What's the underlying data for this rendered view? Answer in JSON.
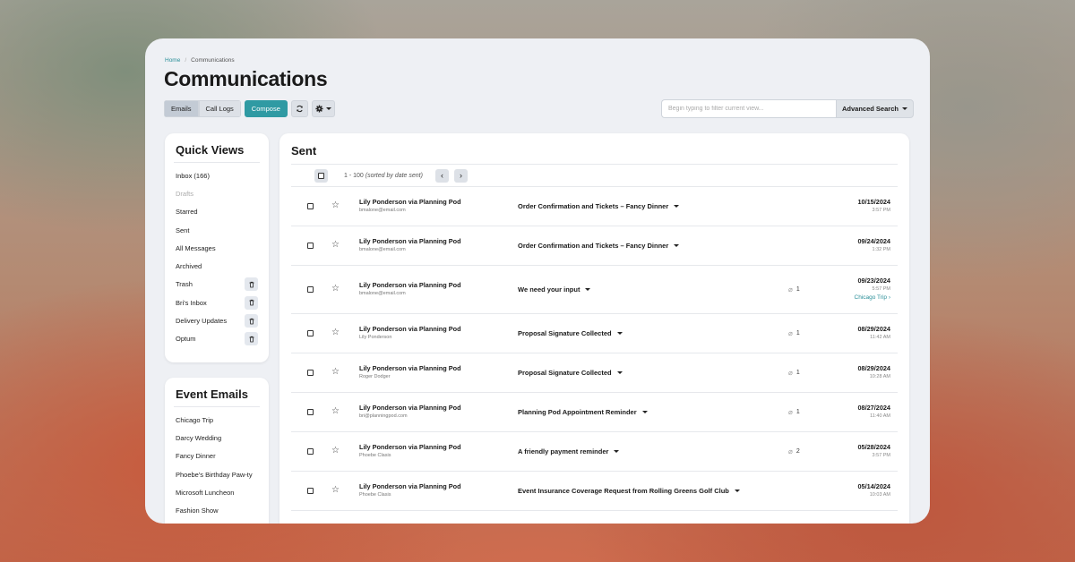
{
  "breadcrumb": {
    "home": "Home",
    "sep": "/",
    "current": "Communications"
  },
  "page": {
    "title": "Communications"
  },
  "toolbar": {
    "emails": "Emails",
    "call_logs": "Call Logs",
    "compose": "Compose",
    "refresh_icon": "refresh-icon",
    "gear_icon": "gear-icon"
  },
  "search": {
    "placeholder": "Begin typing to filter current view...",
    "advanced": "Advanced Search"
  },
  "quick_views": {
    "title": "Quick Views",
    "items": [
      {
        "label": "Inbox (166)"
      },
      {
        "label": "Drafts"
      },
      {
        "label": "Starred"
      },
      {
        "label": "Sent"
      },
      {
        "label": "All Messages"
      },
      {
        "label": "Archived"
      },
      {
        "label": "Trash"
      },
      {
        "label": "Bri's Inbox"
      },
      {
        "label": "Delivery Updates"
      },
      {
        "label": "Optum"
      }
    ]
  },
  "event_emails": {
    "title": "Event Emails",
    "items": [
      {
        "label": "Chicago Trip"
      },
      {
        "label": "Darcy Wedding"
      },
      {
        "label": "Fancy Dinner"
      },
      {
        "label": "Phoebe's Birthday Paw-ty"
      },
      {
        "label": "Microsoft Luncheon"
      },
      {
        "label": "Fashion Show"
      }
    ]
  },
  "main": {
    "title": "Sent",
    "pager_text": "1 - 100",
    "pager_sort": "(sorted by date sent)",
    "prev": "‹",
    "next": "›"
  },
  "emails": [
    {
      "from": "Lily Ponderson via Planning Pod",
      "email": "bmalone@email.com",
      "subject": "Order Confirmation and Tickets – Fancy Dinner",
      "attachments": "",
      "date": "10/15/2024",
      "time": "3:57 PM",
      "event": ""
    },
    {
      "from": "Lily Ponderson via Planning Pod",
      "email": "bmalone@email.com",
      "subject": "Order Confirmation and Tickets – Fancy Dinner",
      "attachments": "",
      "date": "09/24/2024",
      "time": "1:32 PM",
      "event": ""
    },
    {
      "from": "Lily Ponderson via Planning Pod",
      "email": "bmalone@email.com",
      "subject": "We need your input",
      "attachments": "1",
      "date": "09/23/2024",
      "time": "5:57 PM",
      "event": "Chicago Trip"
    },
    {
      "from": "Lily Ponderson via Planning Pod",
      "email": "Lily Ponderson",
      "subject": "Proposal Signature Collected",
      "attachments": "1",
      "date": "08/29/2024",
      "time": "11:42 AM",
      "event": ""
    },
    {
      "from": "Lily Ponderson via Planning Pod",
      "email": "Roger Dodger",
      "subject": "Proposal Signature Collected",
      "attachments": "1",
      "date": "08/29/2024",
      "time": "10:28 AM",
      "event": ""
    },
    {
      "from": "Lily Ponderson via Planning Pod",
      "email": "bri@planningpod.com",
      "subject": "Planning Pod Appointment Reminder",
      "attachments": "1",
      "date": "08/27/2024",
      "time": "11:40 AM",
      "event": ""
    },
    {
      "from": "Lily Ponderson via Planning Pod",
      "email": "Phoebe Clasis",
      "subject": "A friendly payment reminder",
      "attachments": "2",
      "date": "05/28/2024",
      "time": "3:57 PM",
      "event": ""
    },
    {
      "from": "Lily Ponderson via Planning Pod",
      "email": "Phoebe Clasis",
      "subject": "Event Insurance Coverage Request from Rolling Greens Golf Club",
      "attachments": "",
      "date": "05/14/2024",
      "time": "10:03 AM",
      "event": ""
    }
  ]
}
